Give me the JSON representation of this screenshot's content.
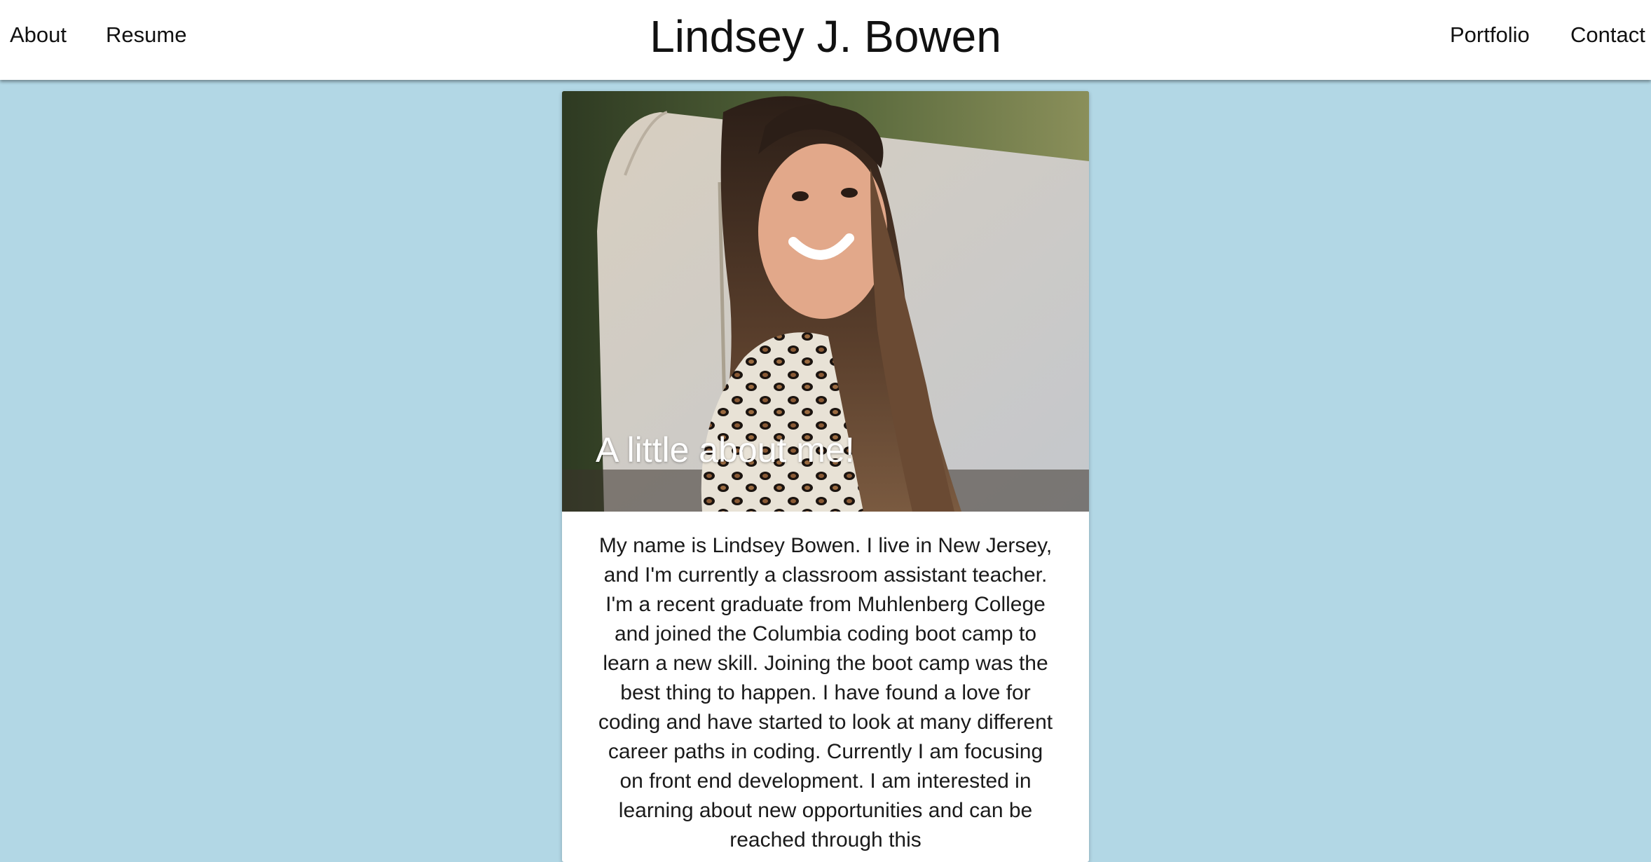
{
  "nav": {
    "about": "About",
    "resume": "Resume",
    "portfolio": "Portfolio",
    "contact": "Contact"
  },
  "site": {
    "title": "Lindsey J. Bowen"
  },
  "card": {
    "image_alt": "Photo of Lindsey Bowen smiling outdoors in a leopard print sweater",
    "title": "A little about me!",
    "body": "My name is Lindsey Bowen. I live in New Jersey, and I'm currently a classroom assistant teacher. I'm a recent graduate from Muhlenberg College and joined the Columbia coding boot camp to learn a new skill. Joining the boot camp was the best thing to happen. I have found a love for coding and have started to look at many different career paths in coding. Currently I am focusing on front end development. I am interested in learning about new opportunities and can be reached through this"
  },
  "colors": {
    "page_background": "#b2d7e5",
    "navbar_background": "#ffffff",
    "card_background": "#ffffff",
    "text": "#111111"
  }
}
